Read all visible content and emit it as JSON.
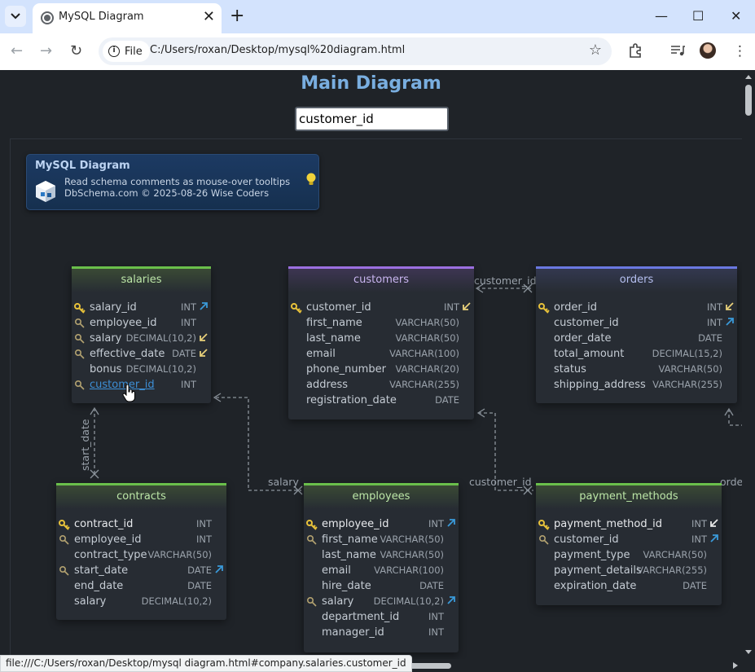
{
  "browser": {
    "tab_title": "MySQL Diagram",
    "url_chip": "File",
    "url": "C:/Users/roxan/Desktop/mysql%20diagram.html",
    "status_url": "file:///C:/Users/roxan/Desktop/mysql diagram.html#company.salaries.customer_id"
  },
  "page": {
    "title": "Main Diagram",
    "search_value": "customer_id"
  },
  "info": {
    "title": "MySQL Diagram",
    "line1": "Read schema comments as mouse-over tooltips",
    "line2": "DbSchema.com © 2025-08-26 Wise Coders"
  },
  "connector_labels": {
    "customers_orders": "customer_id",
    "salaries_contracts": "start_date",
    "salaries_employees": "salary",
    "customers_payment": "customer_id",
    "orders_right": "orde"
  },
  "tables": {
    "salaries": {
      "name": "salaries",
      "columns": [
        {
          "name": "salary_id",
          "type": "INT"
        },
        {
          "name": "employee_id",
          "type": "INT"
        },
        {
          "name": "salary",
          "type": "DECIMAL(10,2)"
        },
        {
          "name": "effective_date",
          "type": "DATE"
        },
        {
          "name": "bonus",
          "type": "DECIMAL(10,2)"
        },
        {
          "name": "customer_id",
          "type": "INT"
        }
      ]
    },
    "customers": {
      "name": "customers",
      "columns": [
        {
          "name": "customer_id",
          "type": "INT"
        },
        {
          "name": "first_name",
          "type": "VARCHAR(50)"
        },
        {
          "name": "last_name",
          "type": "VARCHAR(50)"
        },
        {
          "name": "email",
          "type": "VARCHAR(100)"
        },
        {
          "name": "phone_number",
          "type": "VARCHAR(20)"
        },
        {
          "name": "address",
          "type": "VARCHAR(255)"
        },
        {
          "name": "registration_date",
          "type": "DATE"
        }
      ]
    },
    "orders": {
      "name": "orders",
      "columns": [
        {
          "name": "order_id",
          "type": "INT"
        },
        {
          "name": "customer_id",
          "type": "INT"
        },
        {
          "name": "order_date",
          "type": "DATE"
        },
        {
          "name": "total_amount",
          "type": "DECIMAL(15,2)"
        },
        {
          "name": "status",
          "type": "VARCHAR(50)"
        },
        {
          "name": "shipping_address",
          "type": "VARCHAR(255)"
        }
      ]
    },
    "contracts": {
      "name": "contracts",
      "columns": [
        {
          "name": "contract_id",
          "type": "INT"
        },
        {
          "name": "employee_id",
          "type": "INT"
        },
        {
          "name": "contract_type",
          "type": "VARCHAR(50)"
        },
        {
          "name": "start_date",
          "type": "DATE"
        },
        {
          "name": "end_date",
          "type": "DATE"
        },
        {
          "name": "salary",
          "type": "DECIMAL(10,2)"
        }
      ]
    },
    "employees": {
      "name": "employees",
      "columns": [
        {
          "name": "employee_id",
          "type": "INT"
        },
        {
          "name": "first_name",
          "type": "VARCHAR(50)"
        },
        {
          "name": "last_name",
          "type": "VARCHAR(50)"
        },
        {
          "name": "email",
          "type": "VARCHAR(100)"
        },
        {
          "name": "hire_date",
          "type": "DATE"
        },
        {
          "name": "salary",
          "type": "DECIMAL(10,2)"
        },
        {
          "name": "department_id",
          "type": "INT"
        },
        {
          "name": "manager_id",
          "type": "INT"
        }
      ]
    },
    "payment_methods": {
      "name": "payment_methods",
      "columns": [
        {
          "name": "payment_method_id",
          "type": "INT"
        },
        {
          "name": "customer_id",
          "type": "INT"
        },
        {
          "name": "payment_type",
          "type": "VARCHAR(50)"
        },
        {
          "name": "payment_details",
          "type": "VARCHAR(255)"
        },
        {
          "name": "expiration_date",
          "type": "DATE"
        }
      ]
    }
  }
}
